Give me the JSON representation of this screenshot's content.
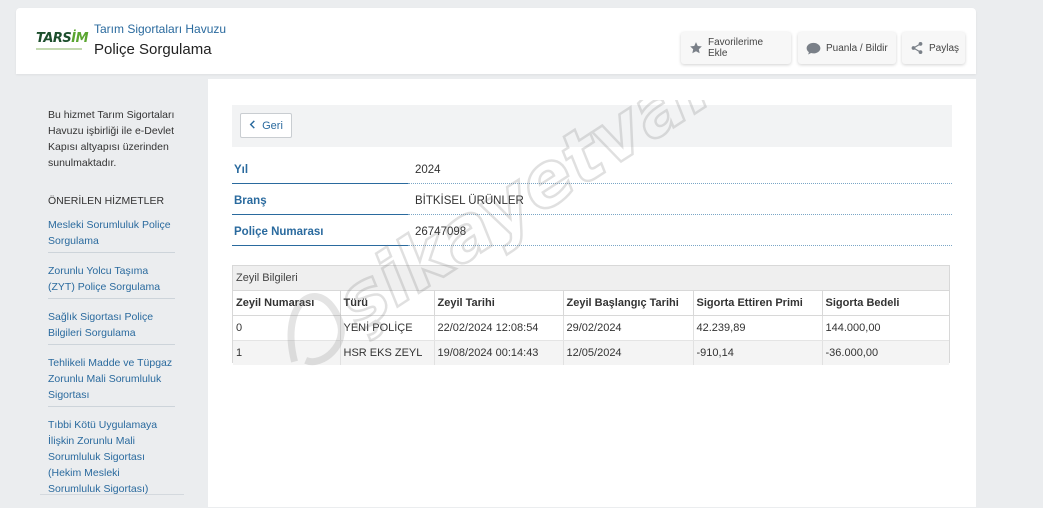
{
  "header": {
    "logo_text": "TARSİM",
    "subtitle": "Tarım Sigortaları Havuzu",
    "title": "Poliçe Sorgulama",
    "buttons": {
      "favorite": "Favorilerime Ekle",
      "rate": "Puanla / Bildir",
      "share": "Paylaş"
    }
  },
  "sidebar": {
    "info": "Bu hizmet Tarım Sigortaları Havuzu işbirliği ile e-Devlet Kapısı altyapısı üzerinden sunulmaktadır.",
    "heading": "ÖNERİLEN HİZMETLER",
    "items": [
      "Mesleki Sorumluluk Poliçe Sorgulama",
      "Zorunlu Yolcu Taşıma (ZYT) Poliçe Sorgulama",
      "Sağlık Sigortası Poliçe Bilgileri Sorgulama",
      "Tehlikeli Madde ve Tüpgaz Zorunlu Mali Sorumluluk Sigortası",
      "Tıbbi Kötü Uygulamaya İlişkin Zorunlu Mali Sorumluluk Sigortası (Hekim Mesleki Sorumluluk Sigortası)"
    ]
  },
  "main": {
    "back_label": "Geri",
    "fields": [
      {
        "label": "Yıl",
        "value": "2024"
      },
      {
        "label": "Branş",
        "value": "BİTKİSEL ÜRÜNLER"
      },
      {
        "label": "Poliçe Numarası",
        "value": "26747098"
      }
    ],
    "panel_title": "Zeyil Bilgileri",
    "table": {
      "columns": [
        "Zeyil Numarası",
        "Türü",
        "Zeyil Tarihi",
        "Zeyil Başlangıç Tarihi",
        "Sigorta Ettiren Primi",
        "Sigorta Bedeli"
      ],
      "rows": [
        [
          "0",
          "YENİ POLİÇE",
          "22/02/2024 12:08:54",
          "29/02/2024",
          "42.239,89",
          "144.000,00"
        ],
        [
          "1",
          "HSR EKS ZEYL",
          "19/08/2024 00:14:43",
          "12/05/2024",
          "-910,14",
          "-36.000,00"
        ]
      ]
    }
  },
  "watermark": "şikayetvar",
  "colors": {
    "link": "#2a6a9e",
    "logo_dark": "#1d4f2d",
    "logo_green": "#5aa530"
  }
}
